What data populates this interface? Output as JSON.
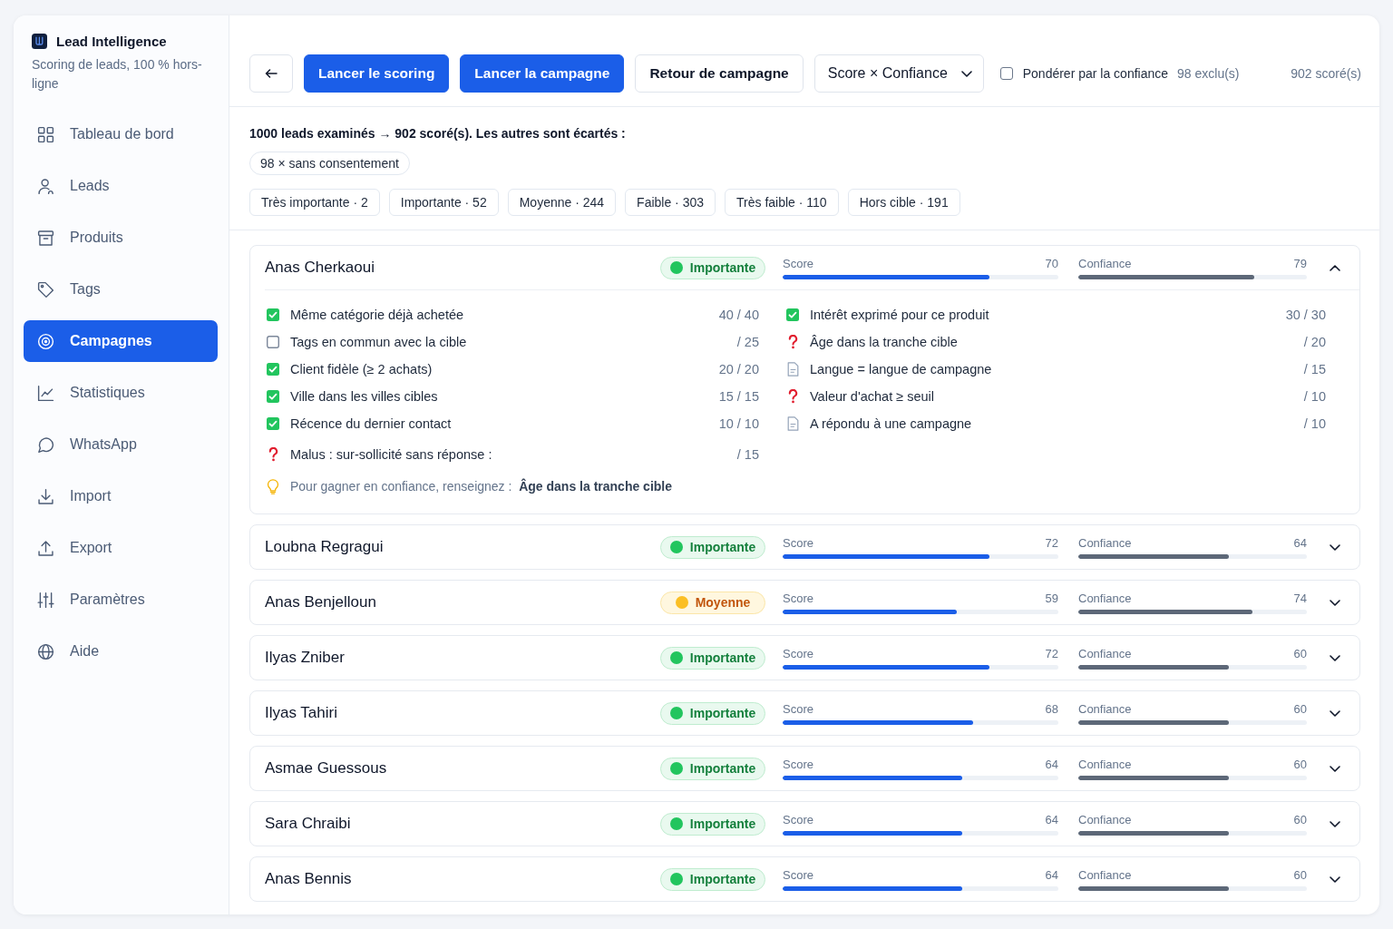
{
  "sidebar": {
    "brand": "Lead Intelligence",
    "subtitle": "Scoring de leads, 100 % hors-ligne",
    "items": [
      {
        "label": "Tableau de bord",
        "selected": false
      },
      {
        "label": "Leads",
        "selected": false
      },
      {
        "label": "Produits",
        "selected": false
      },
      {
        "label": "Tags",
        "selected": false
      },
      {
        "label": "Campagnes",
        "selected": true
      },
      {
        "label": "Statistiques",
        "selected": false
      },
      {
        "label": "WhatsApp",
        "selected": false
      },
      {
        "label": "Import",
        "selected": false
      },
      {
        "label": "Export",
        "selected": false
      },
      {
        "label": "Paramètres",
        "selected": false
      },
      {
        "label": "Aide",
        "selected": false
      }
    ]
  },
  "toolbar": {
    "buttons": [
      {
        "label": "Lancer le scoring",
        "kind": "primary"
      },
      {
        "label": "Lancer la campagne",
        "kind": "primary"
      },
      {
        "label": "Retour de campagne",
        "kind": "secondary"
      }
    ],
    "sort_select": {
      "value": "Score × Confiance"
    },
    "weight_toggle": {
      "label": "Pondérer par la confiance",
      "checked": false
    },
    "excluded": "98 exclu(s)",
    "scored": "902 scoré(s)"
  },
  "summary": {
    "text": "1000 leads examinés → 902 scoré(s). Les autres sont écartés :",
    "reasons": [
      "98 × sans consentement"
    ],
    "filters": [
      {
        "label": "Très importante · 2",
        "selected": false
      },
      {
        "label": "Importante · 52",
        "selected": false
      },
      {
        "label": "Moyenne · 244",
        "selected": false
      },
      {
        "label": "Faible · 303",
        "selected": false
      },
      {
        "label": "Très faible · 110",
        "selected": false
      },
      {
        "label": "Hors cible · 191",
        "selected": false
      }
    ]
  },
  "leads": [
    {
      "name": "Anas Cherkaoui",
      "priority": {
        "label": "Importante",
        "kind": "important",
        "color": "#22c55e"
      },
      "score": {
        "label": "Score",
        "value": "70",
        "level": 0.75
      },
      "confidence": {
        "label": "Confiance",
        "value": "79",
        "level": 0.77
      },
      "expanded": true,
      "details": {
        "criteria_left": [
          {
            "label": "Même catégorie déjà achetée",
            "points": "40 / 40",
            "kind": "check",
            "checked": true
          },
          {
            "label": "Tags en commun avec la cible",
            "points": "/ 25",
            "kind": "check",
            "checked": false
          },
          {
            "label": "Client fidèle (≥ 2 achats)",
            "points": "20 / 20",
            "kind": "check",
            "checked": true
          },
          {
            "label": "Ville dans les villes cibles",
            "points": "15 / 15",
            "kind": "check",
            "checked": true
          },
          {
            "label": "Récence du dernier contact",
            "points": "10 / 10",
            "kind": "check",
            "checked": true
          }
        ],
        "criteria_right": [
          {
            "label": "Intérêt exprimé pour ce produit",
            "points": "30 / 30",
            "kind": "check",
            "checked": true
          },
          {
            "label": "Âge dans la tranche cible",
            "points": "/ 20",
            "kind": "unknown"
          },
          {
            "label": "Langue = langue de campagne",
            "points": "/ 15",
            "kind": "missing"
          },
          {
            "label": "Valeur d'achat ≥ seuil",
            "points": "/ 10",
            "kind": "unknown"
          },
          {
            "label": "A répondu à une campagne",
            "points": "/ 10",
            "kind": "missing"
          }
        ],
        "penalty": {
          "label": "Malus : sur-sollicité sans réponse :",
          "points": "/ 15",
          "kind": "unknown"
        },
        "hint": "Pour gagner en confiance, renseignez :  **Âge dans la tranche cible**"
      }
    },
    {
      "name": "Loubna Regragui",
      "priority": {
        "label": "Importante",
        "kind": "important",
        "color": "#22c55e"
      },
      "score": {
        "label": "Score",
        "value": "72",
        "level": 0.75
      },
      "confidence": {
        "label": "Confiance",
        "value": "64",
        "level": 0.66
      },
      "expanded": false
    },
    {
      "name": "Anas Benjelloun",
      "priority": {
        "label": "Moyenne",
        "kind": "medium",
        "color": "#fbbf24"
      },
      "score": {
        "label": "Score",
        "value": "59",
        "level": 0.63
      },
      "confidence": {
        "label": "Confiance",
        "value": "74",
        "level": 0.76
      },
      "expanded": false
    },
    {
      "name": "Ilyas Zniber",
      "priority": {
        "label": "Importante",
        "kind": "important",
        "color": "#22c55e"
      },
      "score": {
        "label": "Score",
        "value": "72",
        "level": 0.75
      },
      "confidence": {
        "label": "Confiance",
        "value": "60",
        "level": 0.66
      },
      "expanded": false
    },
    {
      "name": "Ilyas Tahiri",
      "priority": {
        "label": "Importante",
        "kind": "important",
        "color": "#22c55e"
      },
      "score": {
        "label": "Score",
        "value": "68",
        "level": 0.69
      },
      "confidence": {
        "label": "Confiance",
        "value": "60",
        "level": 0.66
      },
      "expanded": false
    },
    {
      "name": "Asmae Guessous",
      "priority": {
        "label": "Importante",
        "kind": "important",
        "color": "#22c55e"
      },
      "score": {
        "label": "Score",
        "value": "64",
        "level": 0.65
      },
      "confidence": {
        "label": "Confiance",
        "value": "60",
        "level": 0.66
      },
      "expanded": false
    },
    {
      "name": "Sara Chraibi",
      "priority": {
        "label": "Importante",
        "kind": "important",
        "color": "#22c55e"
      },
      "score": {
        "label": "Score",
        "value": "64",
        "level": 0.65
      },
      "confidence": {
        "label": "Confiance",
        "value": "60",
        "level": 0.66
      },
      "expanded": false
    },
    {
      "name": "Anas Bennis",
      "priority": {
        "label": "Importante",
        "kind": "important",
        "color": "#22c55e"
      },
      "score": {
        "label": "Score",
        "value": "64",
        "level": 0.65
      },
      "confidence": {
        "label": "Confiance",
        "value": "60",
        "level": 0.66
      },
      "expanded": false
    }
  ]
}
